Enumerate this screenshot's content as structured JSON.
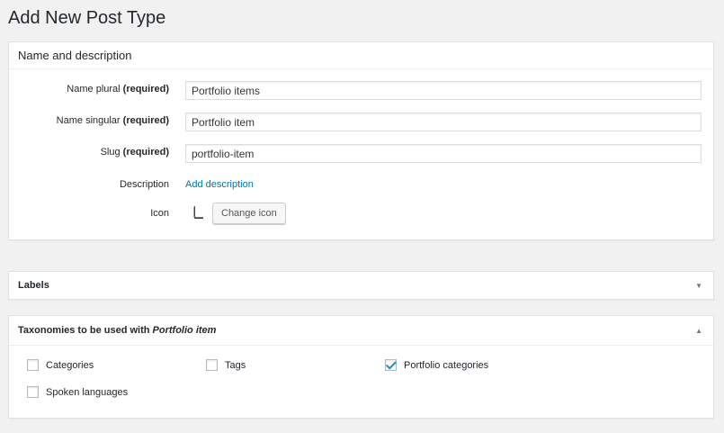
{
  "page": {
    "title": "Add New Post Type"
  },
  "name_box": {
    "header": "Name and description",
    "plural": {
      "label": "Name plural ",
      "req": "(required)",
      "value": "Portfolio items"
    },
    "singular": {
      "label": "Name singular ",
      "req": "(required)",
      "value": "Portfolio item"
    },
    "slug": {
      "label": "Slug ",
      "req": "(required)",
      "value": "portfolio-item"
    },
    "description": {
      "label": "Description",
      "link": "Add description"
    },
    "icon": {
      "label": "Icon",
      "icon_name": "book-icon",
      "button": "Change icon"
    }
  },
  "labels_box": {
    "header": "Labels",
    "arrow": "▼"
  },
  "taxonomies_box": {
    "header_prefix": "Taxonomies to be used with ",
    "header_em": "Portfolio item",
    "arrow": "▲",
    "items": [
      {
        "label": "Categories",
        "checked": false
      },
      {
        "label": "Tags",
        "checked": false
      },
      {
        "label": "Portfolio categories",
        "checked": true
      },
      {
        "label": "Spoken languages",
        "checked": false
      }
    ]
  }
}
